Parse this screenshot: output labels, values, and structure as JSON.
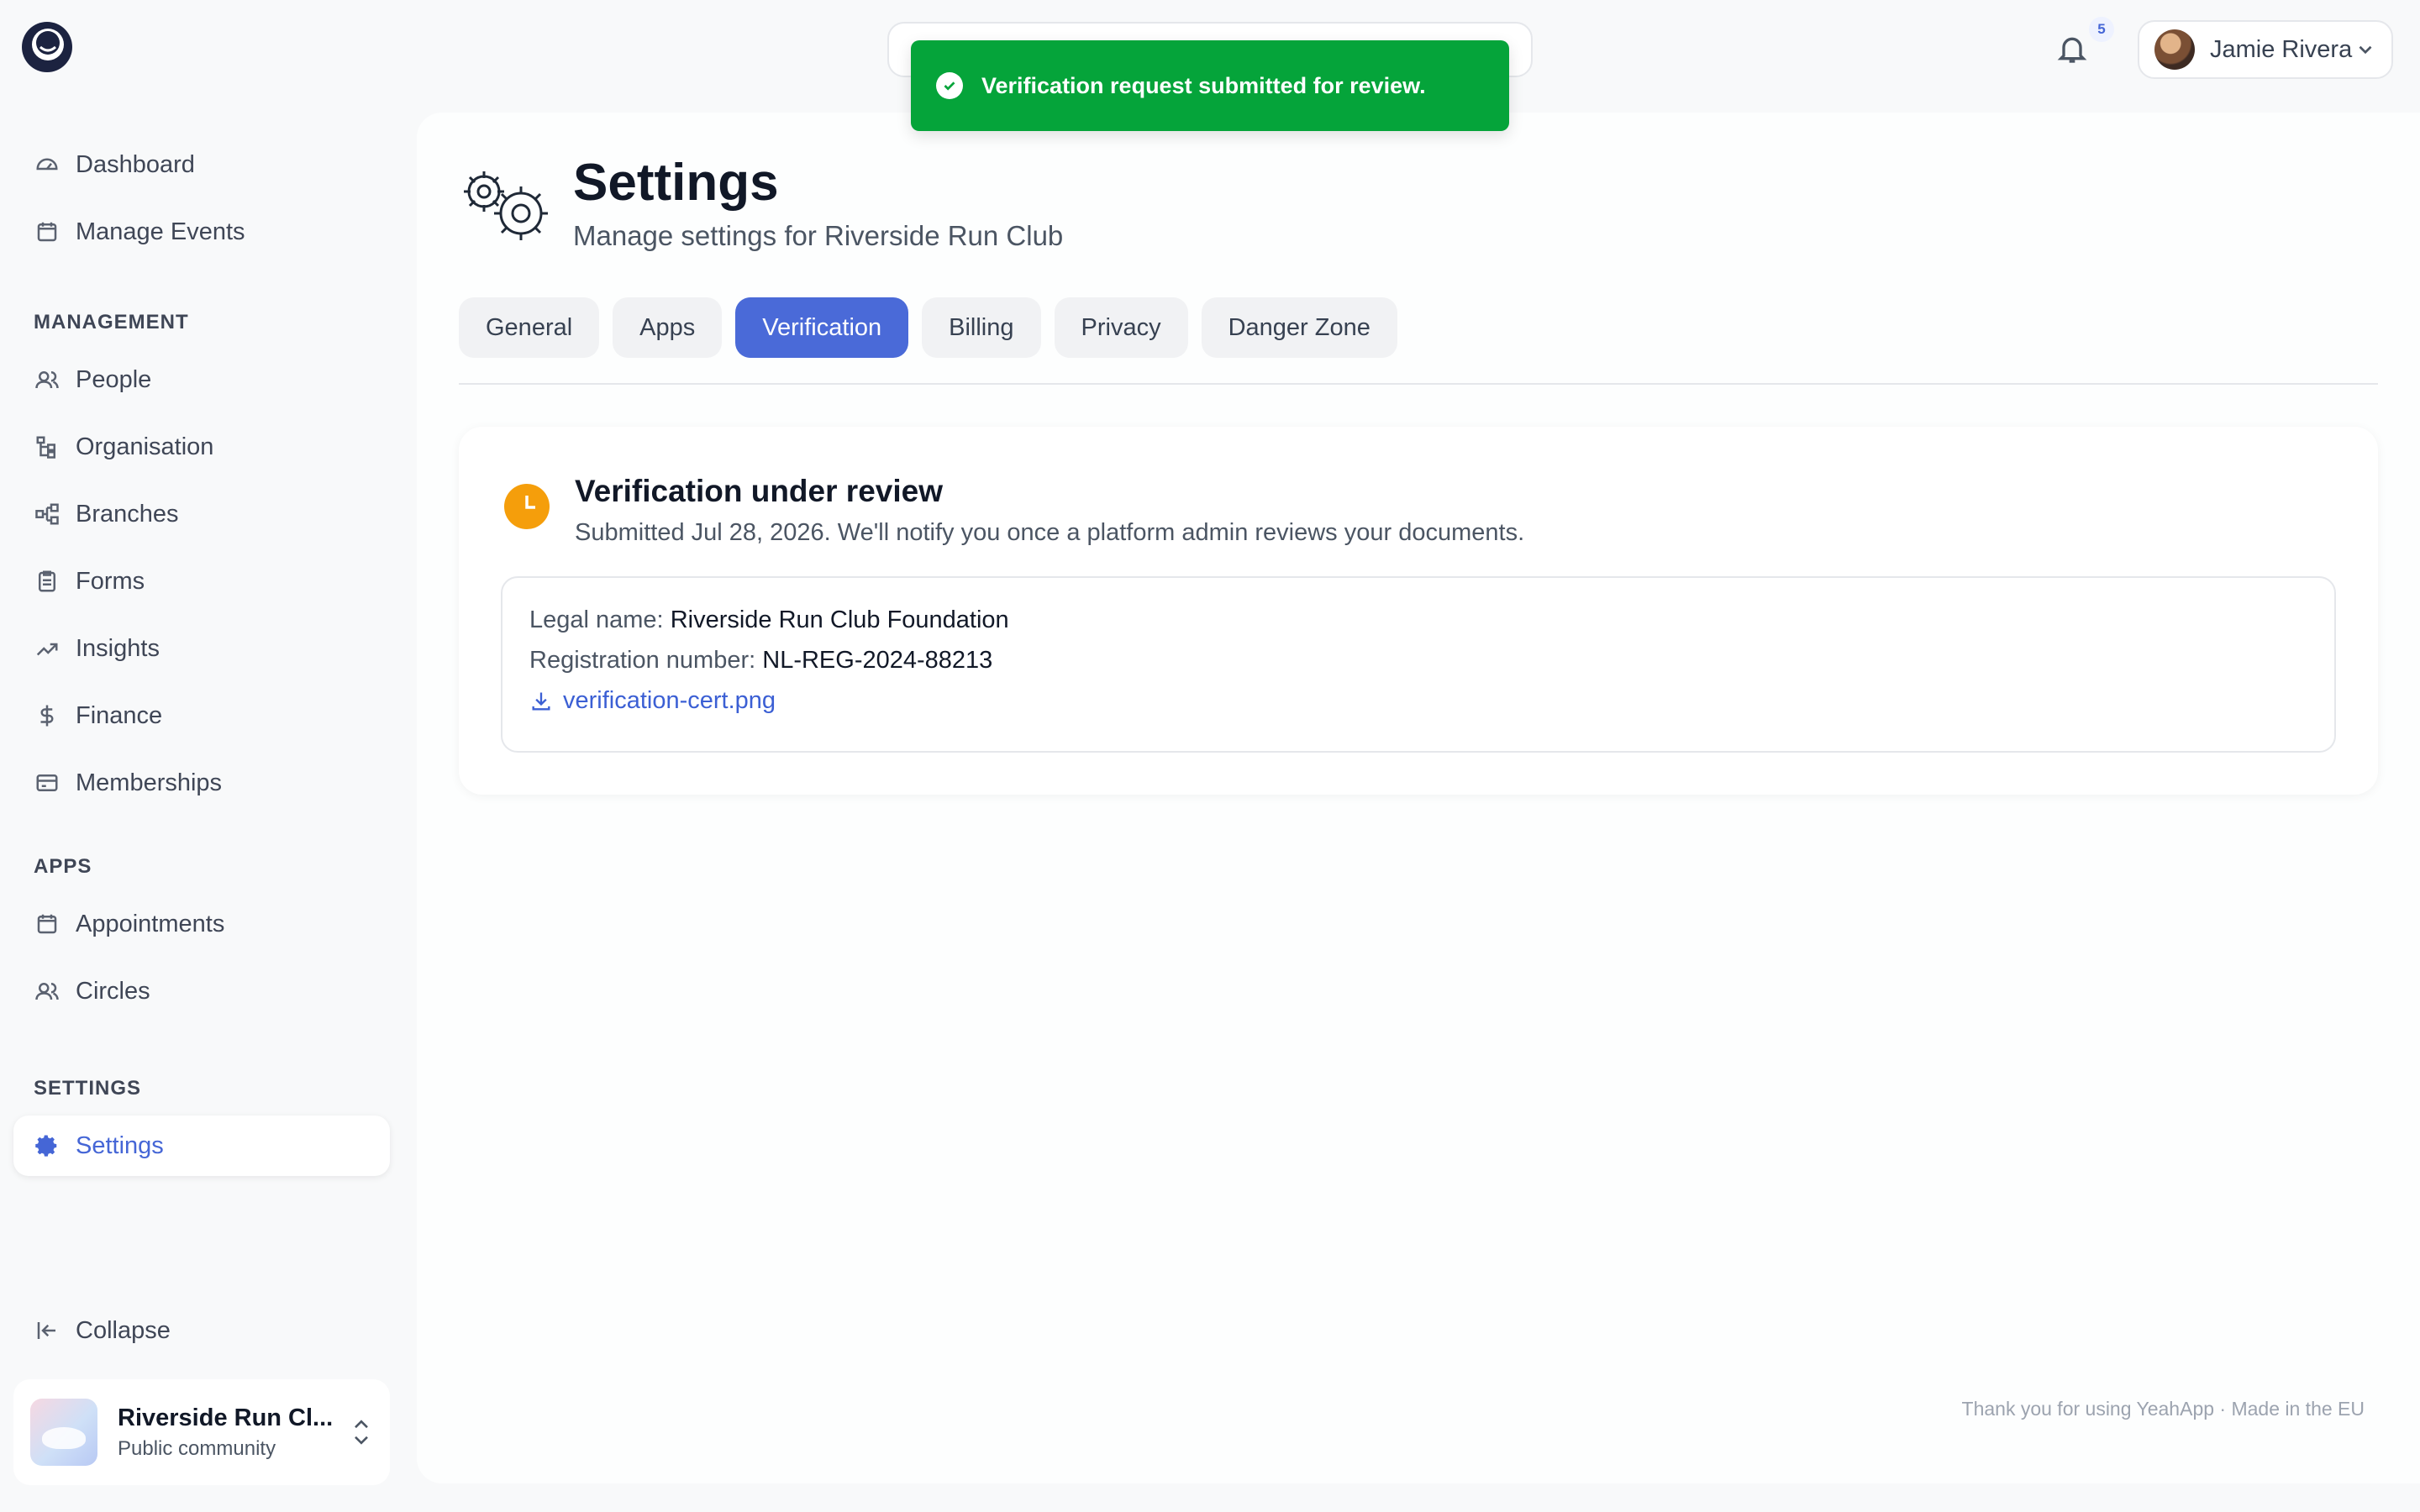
{
  "toast": {
    "message": "Verification request submitted for review."
  },
  "header": {
    "notification_count": "5",
    "user_name": "Jamie Rivera"
  },
  "sidebar": {
    "top_items": [
      {
        "label": "Dashboard",
        "icon": "gauge-icon"
      },
      {
        "label": "Manage Events",
        "icon": "calendar-icon"
      }
    ],
    "management_label": "MANAGEMENT",
    "management_items": [
      {
        "label": "People",
        "icon": "people-icon"
      },
      {
        "label": "Organisation",
        "icon": "org-tree-icon"
      },
      {
        "label": "Branches",
        "icon": "branches-icon"
      },
      {
        "label": "Forms",
        "icon": "clipboard-icon"
      },
      {
        "label": "Insights",
        "icon": "trend-icon"
      },
      {
        "label": "Finance",
        "icon": "dollar-icon"
      },
      {
        "label": "Memberships",
        "icon": "card-icon"
      }
    ],
    "apps_label": "APPS",
    "apps_items": [
      {
        "label": "Appointments",
        "icon": "calendar-icon"
      },
      {
        "label": "Circles",
        "icon": "people-icon"
      }
    ],
    "settings_label": "SETTINGS",
    "settings_items": [
      {
        "label": "Settings",
        "icon": "gear-icon",
        "active": true
      }
    ],
    "collapse_label": "Collapse",
    "org": {
      "name": "Riverside Run Cl...",
      "type": "Public community"
    }
  },
  "page": {
    "title": "Settings",
    "subtitle": "Manage settings for Riverside Run Club",
    "tabs": [
      "General",
      "Apps",
      "Verification",
      "Billing",
      "Privacy",
      "Danger Zone"
    ],
    "active_tab": "Verification"
  },
  "verification": {
    "title": "Verification under review",
    "subtitle": "Submitted Jul 28, 2026. We'll notify you once a platform admin reviews your documents.",
    "legal_name_label": "Legal name:",
    "legal_name_value": "Riverside Run Club Foundation",
    "reg_label": "Registration number:",
    "reg_value": "NL-REG-2024-88213",
    "file_name": "verification-cert.png",
    "status_color": "#f59e0b"
  },
  "footer": {
    "text": "Thank you for using YeahApp · Made in the EU"
  },
  "colors": {
    "accent": "#4a6ad8",
    "success": "#05a43a"
  }
}
